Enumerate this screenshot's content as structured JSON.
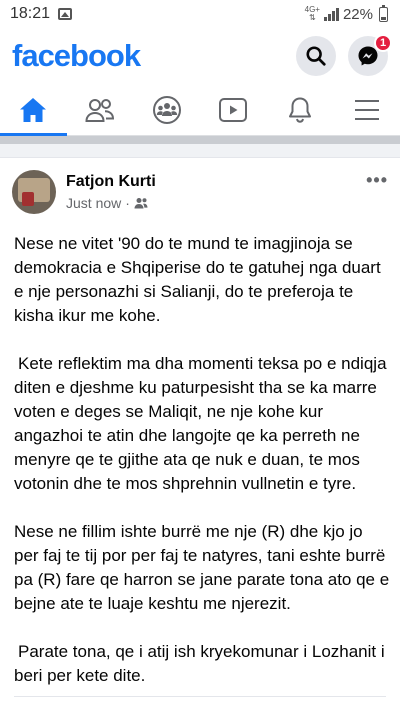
{
  "status_bar": {
    "time": "18:21",
    "network_type": "4G+",
    "battery": "22%"
  },
  "header": {
    "logo": "facebook",
    "search_icon": "search-icon",
    "messenger_icon": "messenger-icon",
    "messenger_badge": "1"
  },
  "nav_tabs": [
    {
      "name": "home",
      "icon": "home-icon",
      "active": true
    },
    {
      "name": "friends",
      "icon": "friends-icon",
      "active": false
    },
    {
      "name": "groups",
      "icon": "groups-icon",
      "active": false
    },
    {
      "name": "watch",
      "icon": "video-icon",
      "active": false
    },
    {
      "name": "notifications",
      "icon": "bell-icon",
      "active": false
    },
    {
      "name": "menu",
      "icon": "menu-icon",
      "active": false
    }
  ],
  "post": {
    "author": "Fatjon Kurti",
    "timestamp": "Just now",
    "audience_icon": "friends-audience-icon",
    "paragraphs": [
      "Nese ne vitet '90 do te mund te imagjinoja se demokracia e Shqiperise do te gatuhej nga duart e nje personazhi si Salianji, do te preferoja te kisha ikur me kohe.",
      " Kete reflektim ma dha momenti teksa po e ndiqja diten e djeshme ku paturpesisht tha se ka marre voten e deges se Maliqit, ne nje kohe kur angazhoi te atin dhe langojte qe ka perreth ne menyre qe te gjithe ata qe nuk e duan, te mos votonin dhe te mos shprehnin vullnetin e tyre.",
      "Nese ne fillim ishte burrë me nje (R) dhe kjo jo per faj te tij por per faj te natyres, tani eshte burrë pa (R) fare qe harron se jane parate tona ato qe e bejne ate te luaje keshtu me njerezit.",
      " Parate tona, qe i atij ish kryekomunar i Lozhanit i beri per kete dite."
    ]
  },
  "colors": {
    "brand": "#1877f2",
    "badge": "#e41e3f"
  }
}
